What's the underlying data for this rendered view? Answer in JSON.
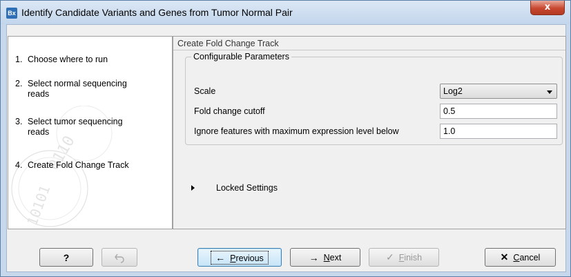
{
  "window": {
    "app_icon": "Bx",
    "title": "Identify Candidate Variants and Genes from Tumor Normal Pair",
    "close_glyph": "x"
  },
  "steps": [
    {
      "num": "1.",
      "label": "Choose where to run"
    },
    {
      "num": "2.",
      "label": "Select normal sequencing reads"
    },
    {
      "num": "3.",
      "label": "Select tumor sequencing reads"
    },
    {
      "num": "4.",
      "label": "Create Fold Change Track"
    }
  ],
  "panel": {
    "section_title": "Create Fold Change Track",
    "group_title": "Configurable Parameters",
    "params": [
      {
        "label": "Scale",
        "value": "Log2",
        "type": "select"
      },
      {
        "label": "Fold change cutoff",
        "value": "0.5",
        "type": "text"
      },
      {
        "label": "Ignore features with maximum expression level below",
        "value": "1.0",
        "type": "text"
      }
    ],
    "locked_settings": "Locked Settings"
  },
  "buttons": {
    "help": "?",
    "previous_icon": "←",
    "previous_pre": "",
    "previous_u": "P",
    "previous_post": "revious",
    "next_icon": "→",
    "next_u": "N",
    "next_post": "ext",
    "finish_icon": "✓",
    "finish_u": "F",
    "finish_post": "inish",
    "cancel_icon": "✕",
    "cancel_u": "C",
    "cancel_post": "ancel"
  },
  "icons": {
    "app": "bx-app-icon",
    "close": "close-icon",
    "reset": "undo-icon",
    "previous": "arrow-left-icon",
    "next": "arrow-right-icon",
    "finish": "check-icon",
    "cancel": "x-icon",
    "expand": "expand-triangle-icon"
  },
  "colors": {
    "titlebar": "#c7d8ec",
    "close": "#c8472f",
    "primary_button": "#c6e4f7"
  }
}
